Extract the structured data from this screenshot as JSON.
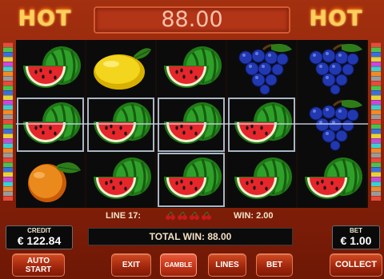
{
  "header": {
    "logo_left": "HOT",
    "logo_right": "HOT",
    "win_display": "88.00"
  },
  "reels": [
    [
      "watermelon",
      "watermelon",
      "orange"
    ],
    [
      "lemon",
      "watermelon",
      "watermelon"
    ],
    [
      "watermelon",
      "watermelon",
      "watermelon"
    ],
    [
      "grapes",
      "watermelon",
      "watermelon"
    ],
    [
      "grapes",
      "grapes",
      "watermelon"
    ]
  ],
  "winning_cells": [
    [
      0,
      1
    ],
    [
      1,
      1
    ],
    [
      2,
      1
    ],
    [
      2,
      2
    ],
    [
      3,
      1
    ]
  ],
  "info": {
    "line_label": "LINE 17:",
    "line_win": "WIN: 2.00"
  },
  "credit": {
    "caption": "CREDIT",
    "value": "€ 122.84"
  },
  "bet": {
    "caption": "BET",
    "value": "€ 1.00"
  },
  "total_win": "TOTAL WIN: 88.00",
  "buttons": {
    "auto_line1": "AUTO",
    "auto_line2": "START",
    "exit": "EXIT",
    "gamble": "GAMBLE",
    "lines": "LINES",
    "bet": "BET",
    "collect": "COLLECT"
  },
  "colors": {
    "background": "#8a220a",
    "win_display_text": "#ffc0ac",
    "button": "#a0260c",
    "stripe_palette": [
      "#e84a3c",
      "#4fbf4a",
      "#3a6fe0",
      "#e6d23a",
      "#c94ad6",
      "#3ad0d6",
      "#f08a2a",
      "#9a9a9a"
    ]
  }
}
